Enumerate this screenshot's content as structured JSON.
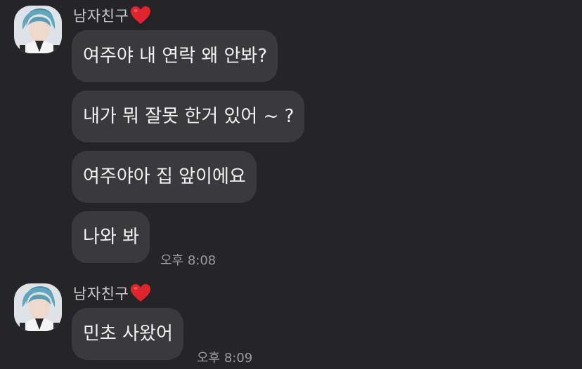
{
  "colors": {
    "background": "#252527",
    "bubble": "#3a3a3c",
    "message_text": "#f2f2f2",
    "sender_text": "#c9c9cb",
    "timestamp_text": "#9a9a9c",
    "heart": "#e0242e"
  },
  "groups": [
    {
      "sender": {
        "name": "남자친구",
        "emoji_icon": "red-heart-icon"
      },
      "messages": [
        {
          "text": "여주야 내 연락 왜 안봐?"
        },
        {
          "text": "내가 뭐 잘못 한거 있어 ~ ?"
        },
        {
          "text": "여주야아 집 앞이에요"
        },
        {
          "text": "나와 봐",
          "time": "오후 8:08"
        }
      ]
    },
    {
      "sender": {
        "name": "남자친구",
        "emoji_icon": "red-heart-icon"
      },
      "messages": [
        {
          "text": "민초 사왔어",
          "time": "오후 8:09"
        }
      ]
    }
  ]
}
